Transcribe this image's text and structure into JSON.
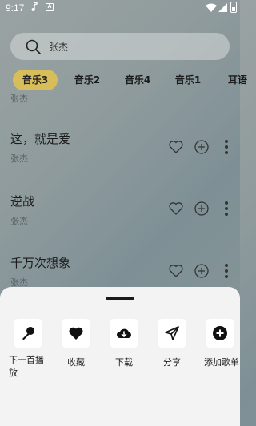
{
  "status_bar": {
    "time": "9:17"
  },
  "search": {
    "query": "张杰"
  },
  "tabs": [
    {
      "label": "音乐3",
      "active": true
    },
    {
      "label": "音乐2",
      "active": false
    },
    {
      "label": "音乐4",
      "active": false
    },
    {
      "label": "音乐1",
      "active": false
    },
    {
      "label": "耳语",
      "active": false
    }
  ],
  "songs": [
    {
      "title": "",
      "artist": "张杰"
    },
    {
      "title": "这，就是爱",
      "artist": "张杰"
    },
    {
      "title": "逆战",
      "artist": "张杰"
    },
    {
      "title": "千万次想象",
      "artist": "张杰"
    }
  ],
  "sheet": {
    "actions": [
      {
        "label": "下一首播放",
        "icon": "microphone-icon"
      },
      {
        "label": "收藏",
        "icon": "heart-icon"
      },
      {
        "label": "下载",
        "icon": "cloud-download-icon"
      },
      {
        "label": "分享",
        "icon": "send-icon"
      },
      {
        "label": "添加歌单",
        "icon": "plus-circle-icon"
      }
    ]
  },
  "colors": {
    "tab_active": "#d8be5b",
    "sheet_bg": "#f3f3f3"
  }
}
